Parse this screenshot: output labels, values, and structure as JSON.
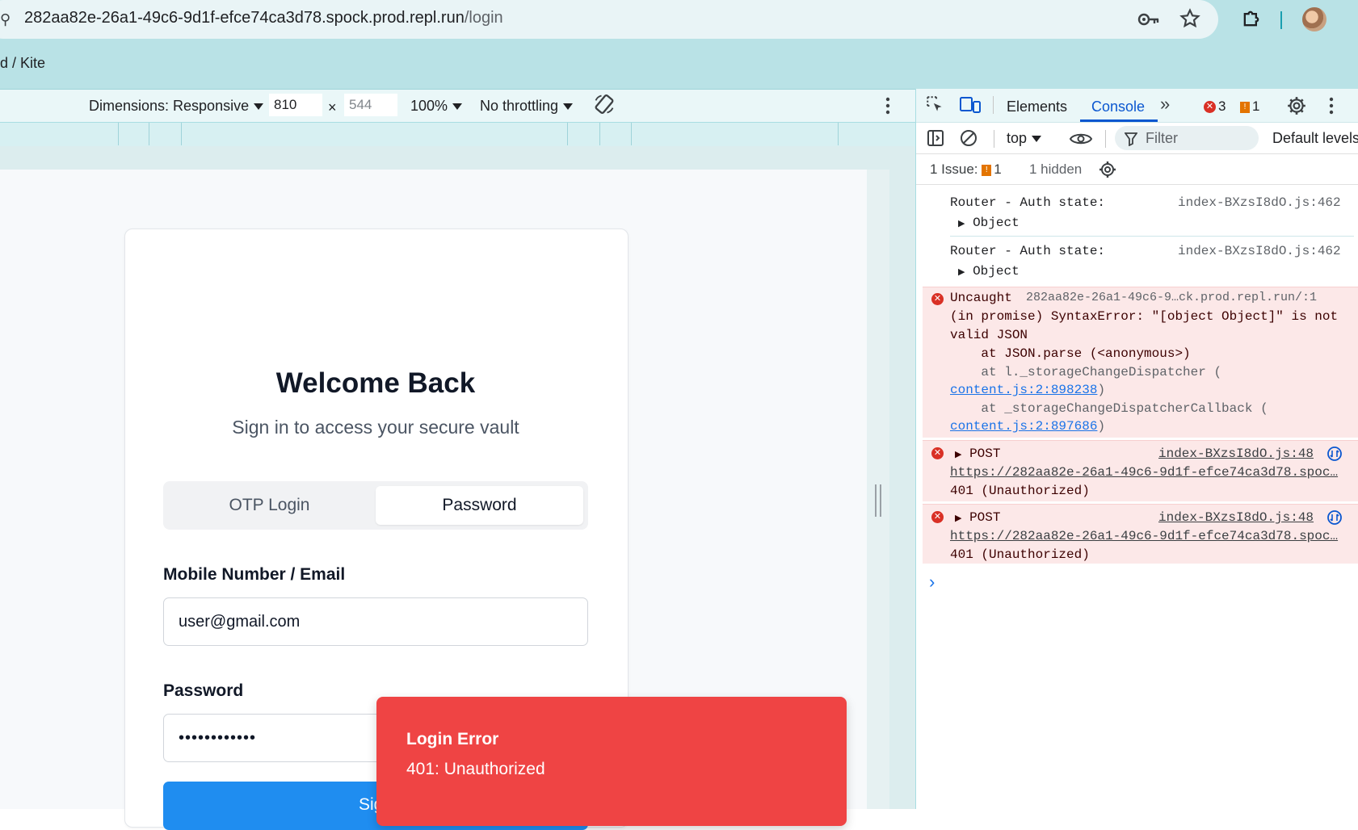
{
  "browser": {
    "url_host": "282aa82e-26a1-49c6-9d1f-efce74ca3d78.spock.prod.repl.run",
    "url_path": "/login",
    "bookmark_text": "d / Kite"
  },
  "device_toolbar": {
    "dimensions_label": "Dimensions: Responsive",
    "width": "810",
    "times": "×",
    "height": "544",
    "zoom": "100%",
    "throttling": "No throttling"
  },
  "login": {
    "title": "Welcome Back",
    "subtitle": "Sign in to access your secure vault",
    "tab_otp": "OTP Login",
    "tab_password": "Password",
    "mobile_label": "Mobile Number / Email",
    "mobile_value": "user@gmail.com",
    "password_label": "Password",
    "password_value": "••••••••••••",
    "signin_label": "Sign"
  },
  "toast": {
    "title": "Login Error",
    "message": "401: Unauthorized"
  },
  "devtools": {
    "tab_elements": "Elements",
    "tab_console": "Console",
    "more": "»",
    "error_count": "3",
    "warning_count": "1",
    "context": "top",
    "filter_placeholder": "Filter",
    "levels": "Default levels",
    "issues_label": "1 Issue:",
    "issues_count": "1",
    "hidden_label": "1 hidden",
    "logs": [
      {
        "text": "Router - Auth state:",
        "source": "index-BXzsI8dO.js:462",
        "object": "Object"
      },
      {
        "text": "Router - Auth state:",
        "source": "index-BXzsI8dO.js:462",
        "object": "Object"
      }
    ],
    "uncaught": {
      "line1": "Uncaught",
      "source": "282aa82e-26a1-49c6-9…ck.prod.repl.run/:1",
      "line2": "(in promise) SyntaxError: \"[object Object]\" is not",
      "line3": "valid JSON",
      "line4": "    at JSON.parse (<anonymous>)",
      "line5": "    at l._storageChangeDispatcher (",
      "link1": "content.js:2:898238",
      "close1": ")",
      "line6": "    at _storageChangeDispatcherCallback (",
      "link2": "content.js:2:897686",
      "close2": ")"
    },
    "posts": [
      {
        "method": "POST",
        "source": "index-BXzsI8dO.js:48",
        "url": "https://282aa82e-26a1-49c6-9d1f-efce74ca3d78.spoc…",
        "status": "401 (Unauthorized)"
      },
      {
        "method": "POST",
        "source": "index-BXzsI8dO.js:48",
        "url": "https://282aa82e-26a1-49c6-9d1f-efce74ca3d78.spoc…",
        "status": "401 (Unauthorized)"
      }
    ],
    "prompt": "›"
  }
}
